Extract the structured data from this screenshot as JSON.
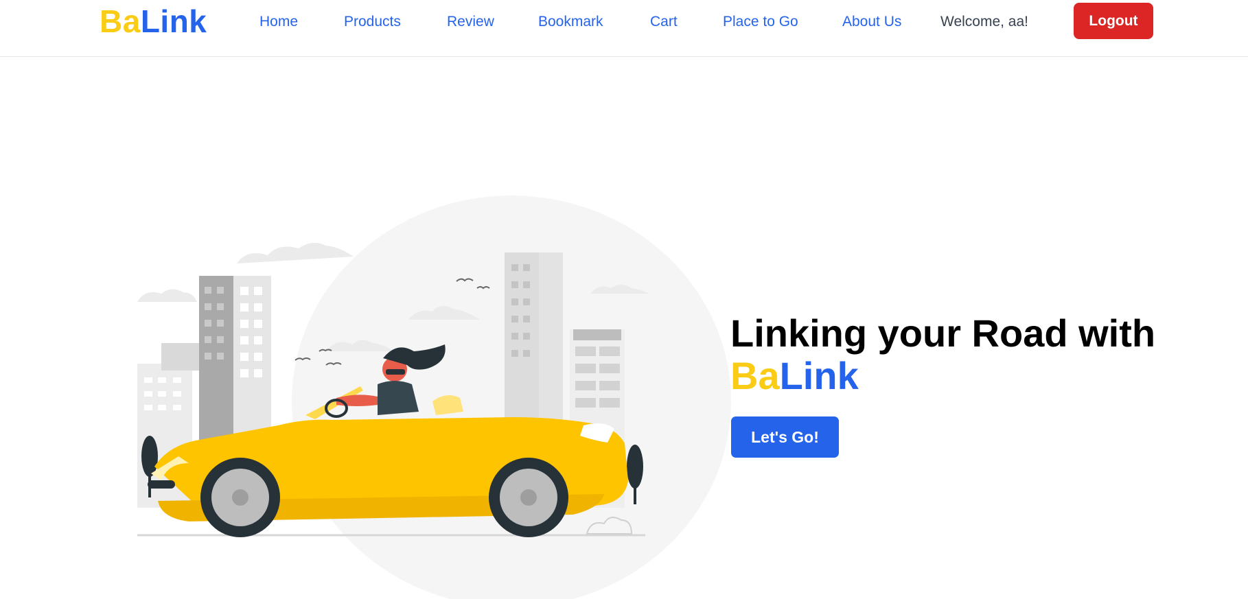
{
  "brand": {
    "part1": "Ba",
    "part2": "Link",
    "color1": "#facc15",
    "color2": "#2563eb"
  },
  "nav": {
    "items": [
      "Home",
      "Products",
      "Review",
      "Bookmark",
      "Cart",
      "Place to Go",
      "About Us"
    ],
    "welcome": "Welcome, aa!",
    "logout": "Logout",
    "logout_color": "#dc2626"
  },
  "hero": {
    "headline_line1": "Linking your Road with",
    "headline_brand1": "Ba",
    "headline_brand2": "Link",
    "cta_label": "Let's Go!",
    "cta_color": "#2563eb",
    "illustration": "woman-driving-yellow-convertible-city-illustration"
  }
}
